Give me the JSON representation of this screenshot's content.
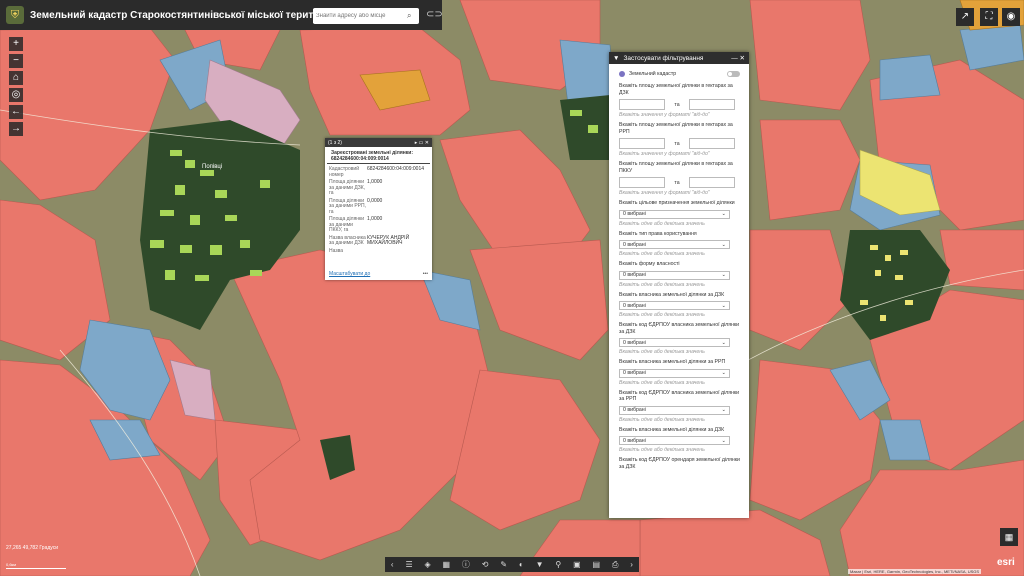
{
  "app": {
    "title": "Земельний кадастр Старокостянтинівської міської територіальної громади",
    "search_placeholder": "Знайти адресу або місце",
    "logo_icon": "coat-of-arms-icon"
  },
  "map": {
    "colors": {
      "parcel_red": "#e9776b",
      "parcel_blue": "#7ea8c9",
      "parcel_green": "#a9d658",
      "parcel_yellow": "#ece472",
      "parcel_pink": "#d8aec1",
      "parcel_orange": "#e3a23a",
      "forest": "#2f4a2a",
      "field_bg": "#8a8a68"
    },
    "place_label": "Попівці"
  },
  "popup": {
    "counter": "(1 з 2)",
    "title": "Зареєстровані земельні ділянки: 6824284600:04:009:0014",
    "rows": [
      {
        "key": "Кадастровий номер",
        "value": "6824284600:04:009:0014"
      },
      {
        "key": "Площа ділянки за даними ДЗК, га",
        "value": "1,0000"
      },
      {
        "key": "Площа ділянки за даними РРП, га",
        "value": "0,0000"
      },
      {
        "key": "Площа ділянки за даними ПККУ, га",
        "value": "1,0000"
      },
      {
        "key": "Назва власника за даними ДЗК",
        "value": "КУЧЕРУК АНДРІЙ МИХАЙЛОВИЧ"
      },
      {
        "key": "Назва",
        "value": ""
      }
    ],
    "zoom_link": "Масштабувати до",
    "more": "•••"
  },
  "filter_panel": {
    "title": "Застосувати фільтрування",
    "layer_name": "Земельний кадастр",
    "range_sep": "та",
    "range_hint": "Вкажіть значення у форматі \"від-до\"",
    "select_value": "0 вибрані",
    "select_hint": "Вкажіть одне або декілька значень",
    "ranges": [
      "Вкажіть площу земельної ділянки в гектарах за ДЗК",
      "Вкажіть площу земельної ділянки в гектарах за РРП",
      "Вкажіть площу земельної ділянки в гектарах за ПККУ"
    ],
    "selects": [
      "Вкажіть цільове призначення земельної ділянки",
      "Вкажіть тип права користування",
      "Вкажіть форму власності",
      "Вкажіть власника земельної ділянки за ДЗК",
      "Вкажіть код ЄДРПОУ власника земельної ділянки за ДЗК",
      "Вкажіть власника земельної ділянки за РРП",
      "Вкажіть код ЄДРПОУ власника земельної ділянки за РРП",
      "Вкажіть власника земельної ділянки за ДЗК",
      "Вкажіть код ЄДРПОУ орендаря земельної ділянки за ДЗК"
    ]
  },
  "status": {
    "coordinates": "27,265 49,782 Градуси",
    "scale": "0,6км",
    "attribution": "Maxar | Esri, HERE, Garmin, GeoTechnologies, Inc., METI/NASA, USGS",
    "esri": "esri"
  }
}
